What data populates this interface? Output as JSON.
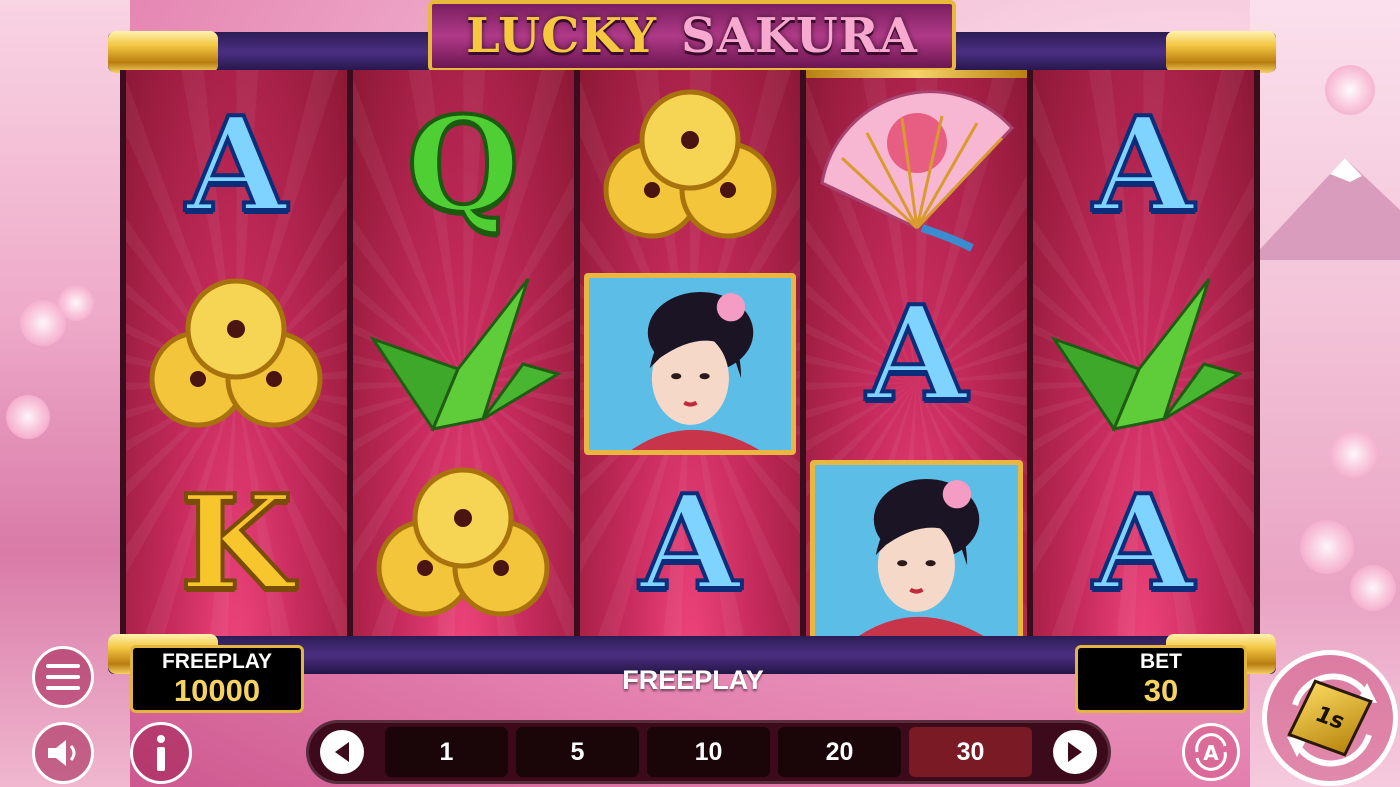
{
  "game": {
    "logo_word1": "LUCKY",
    "logo_word2": "SAKURA"
  },
  "reels": [
    [
      "A",
      "coins",
      "K"
    ],
    [
      "Q",
      "crane",
      "coins"
    ],
    [
      "coins",
      "geisha",
      "A"
    ],
    [
      "fan",
      "A",
      "geisha"
    ],
    [
      "A",
      "crane",
      "A"
    ]
  ],
  "freeplay_box": {
    "label": "FREEPLAY",
    "value": "10000"
  },
  "status_message": "FREEPLAY",
  "bet_box": {
    "label": "BET",
    "value": "30"
  },
  "bet_options": [
    "1",
    "5",
    "10",
    "20",
    "30"
  ],
  "selected_bet": "30",
  "icons": {
    "menu": "menu-icon",
    "sound": "speaker-icon",
    "info": "info-icon",
    "prev": "chevron-left-icon",
    "next": "chevron-right-icon",
    "auto": "autoplay-icon",
    "spin": "spin-icon"
  },
  "spin_label": "1s",
  "auto_label": "A",
  "colors": {
    "gold": "#e3b53e",
    "value_yellow": "#f6d361",
    "reel_red": "#c82c5e",
    "selected_bet_bg": "#7a1a24"
  }
}
